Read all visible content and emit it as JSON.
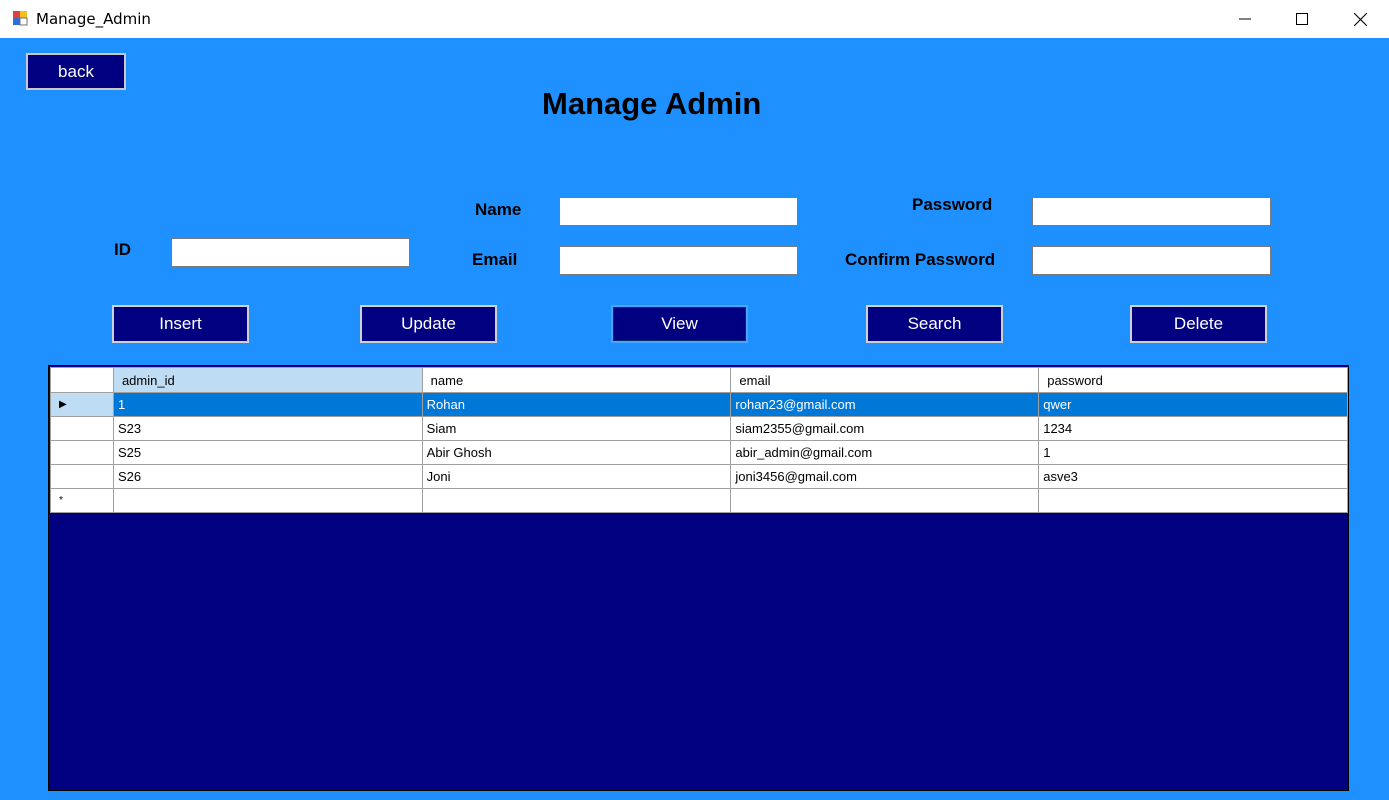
{
  "window": {
    "title": "Manage_Admin",
    "controls": [
      "minimize-icon",
      "maximize-icon",
      "close-icon"
    ]
  },
  "header": {
    "back_label": "back",
    "title": "Manage Admin"
  },
  "form": {
    "id_label": "ID",
    "id_value": "",
    "name_label": "Name",
    "name_value": "",
    "email_label": "Email",
    "email_value": "",
    "password_label": "Password",
    "password_value": "",
    "confirm_password_label": "Confirm Password",
    "confirm_password_value": ""
  },
  "actions": {
    "insert": "Insert",
    "update": "Update",
    "view": "View",
    "search": "Search",
    "delete": "Delete"
  },
  "grid": {
    "columns": [
      "admin_id",
      "name",
      "email",
      "password"
    ],
    "rows": [
      [
        "1",
        "Rohan",
        "rohan23@gmail.com",
        "qwer"
      ],
      [
        "S23",
        "Siam",
        "siam2355@gmail.com",
        "1234"
      ],
      [
        "S25",
        "Abir Ghosh",
        "abir_admin@gmail.com",
        "1"
      ],
      [
        "S26",
        "Joni",
        "joni3456@gmail.com",
        "asve3"
      ]
    ],
    "selected_row": 0,
    "current_row_glyph": "▶",
    "new_row_glyph": "*"
  },
  "colors": {
    "background": "#1e90ff",
    "button": "#000080",
    "grid_background": "#000080",
    "selection": "#0078d7"
  }
}
